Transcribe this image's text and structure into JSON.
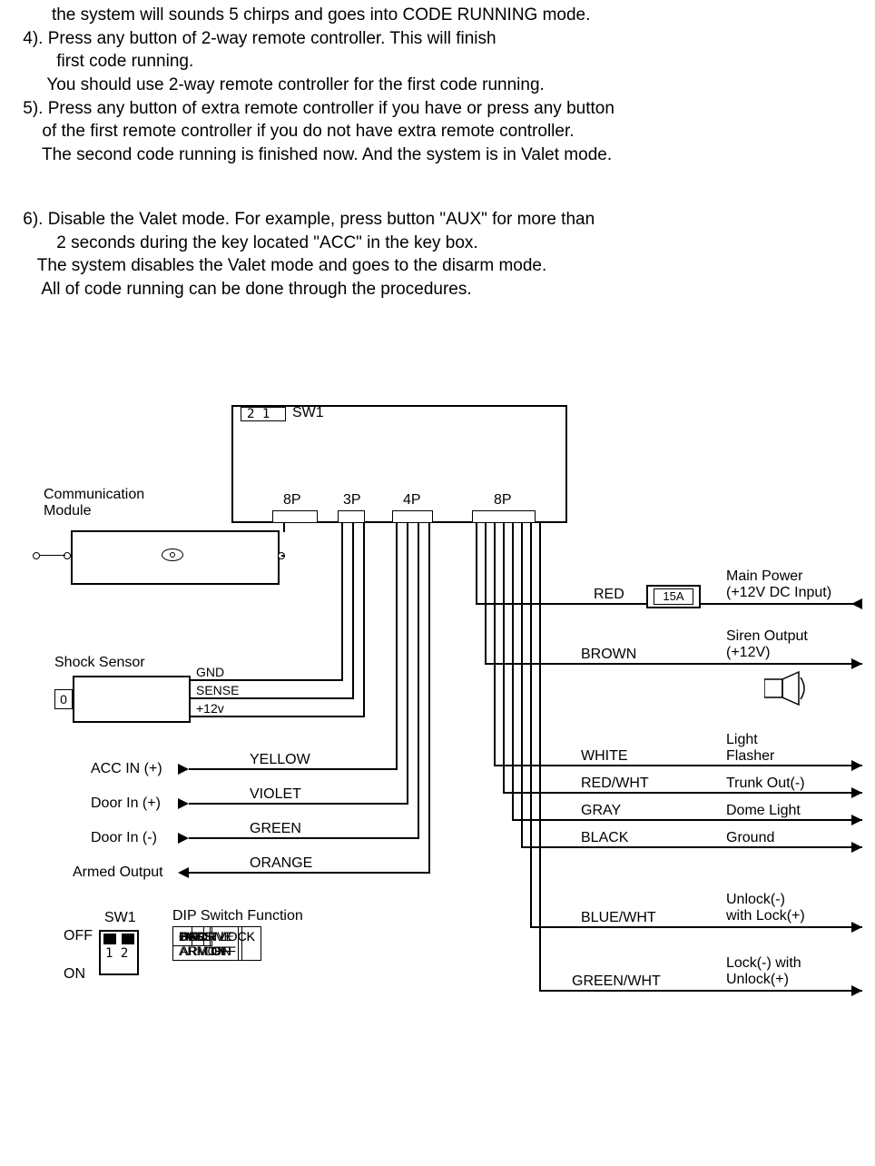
{
  "text": {
    "l1": "       the system will sounds 5 chirps and goes into CODE RUNNING mode.",
    "l2": " 4). Press any button of 2-way remote controller. This will finish",
    "l3": "        first code running.",
    "l4": "      You should use 2-way remote controller for the first code running.",
    "l5": " 5). Press any button of extra remote controller if you have or press any button",
    "l6": "     of the first remote controller if you do not have extra remote controller.",
    "l7": "     The second code running is finished now. And the system is in Valet mode.",
    "l8": " ",
    "l9": " 6). Disable the Valet mode. For example, press button \"AUX\" for more than",
    "l10": "        2 seconds during the key located \"ACC\" in the key box.",
    "l11": "    The system disables the Valet mode and goes to the disarm mode.",
    "l12": "     All of code running can be done through the procedures."
  },
  "diagram": {
    "main": {
      "sw1_21": "2  1",
      "sw1": "SW1",
      "ports": {
        "p8a": "8P",
        "p3": "3P",
        "p4": "4P",
        "p8b": "8P"
      },
      "comm_module": "Communication\nModule",
      "shock_sensor": "Shock Sensor",
      "shock_sensor_inside": "0",
      "shock_wires": {
        "gnd": "GND",
        "sense": "SENSE",
        "p12v": "+12v"
      }
    },
    "left_inputs": [
      {
        "name": "ACC IN (+)",
        "color": "YELLOW"
      },
      {
        "name": "Door In (+)",
        "color": "VIOLET"
      },
      {
        "name": "Door In (-)",
        "color": "GREEN"
      },
      {
        "name": "Armed Output",
        "color": "ORANGE"
      }
    ],
    "right_outputs": [
      {
        "color": "RED",
        "name": "Main Power\n(+12V DC Input)",
        "fuse": "15A"
      },
      {
        "color": "BROWN",
        "name": "Siren Output\n(+12V)"
      },
      {
        "color": "WHITE",
        "name": "Light\nFlasher"
      },
      {
        "color": "RED/WHT",
        "name": "Trunk Out(-)"
      },
      {
        "color": "GRAY",
        "name": "Dome Light"
      },
      {
        "color": "BLACK",
        "name": "Ground"
      },
      {
        "color": "BLUE/WHT",
        "name": "Unlock(-)\nwith Lock(+)"
      },
      {
        "color": "GREEN/WHT",
        "name": "Lock(-) with\nUnlock(+)"
      }
    ],
    "sw1_detail": {
      "title": "SW1",
      "off": "OFF",
      "on": "ON",
      "n12": "1   2"
    },
    "dip": {
      "title": "DIP Switch Function",
      "rows": [
        [
          "SW1",
          "1",
          "2"
        ],
        [
          "OFF",
          "PASSIVE\nARM OFF",
          "DOOR LOCK\nOFF"
        ],
        [
          "ON",
          "PASSIVE\nARM ON",
          "DOOR LOCK\nON"
        ]
      ]
    }
  }
}
